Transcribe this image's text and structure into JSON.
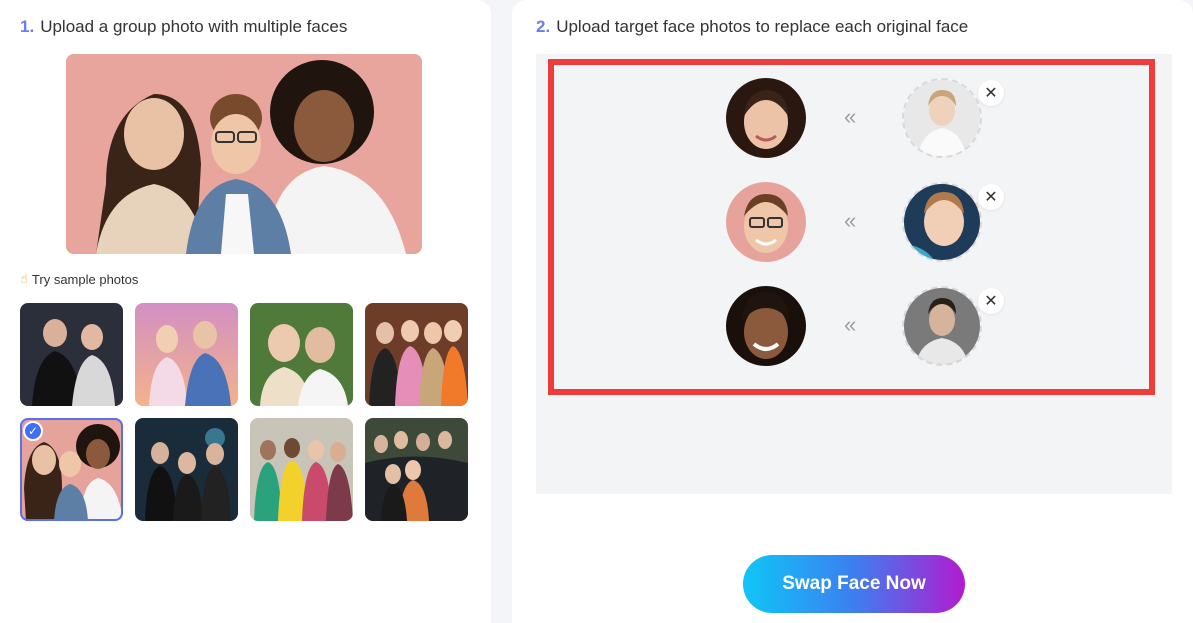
{
  "left_panel": {
    "step_number": "1.",
    "step_title": "Upload a group photo with multiple faces",
    "sample_label": "Try sample photos",
    "samples": [
      {
        "bg": "#2b2f3a",
        "selected": false
      },
      {
        "bg": "#c98bb8",
        "selected": false
      },
      {
        "bg": "#4f7a3a",
        "selected": false
      },
      {
        "bg": "#6e3d2a",
        "selected": false
      },
      {
        "bg": "#e6a39c",
        "selected": true
      },
      {
        "bg": "#1a2b3a",
        "selected": false
      },
      {
        "bg": "#c9c4b8",
        "selected": false
      },
      {
        "bg": "#3d4a3a",
        "selected": false
      }
    ]
  },
  "right_panel": {
    "step_number": "2.",
    "step_title": "Upload target face photos to replace each original face",
    "arrow_glyph": "«",
    "remove_glyph": "✕",
    "swap_button_label": "Swap Face Now"
  },
  "colors": {
    "accent": "#6b7cf6",
    "highlight_border": "#ee3b3b",
    "button_gradient_start": "#0fc6f7",
    "button_gradient_end": "#b21bd0"
  }
}
